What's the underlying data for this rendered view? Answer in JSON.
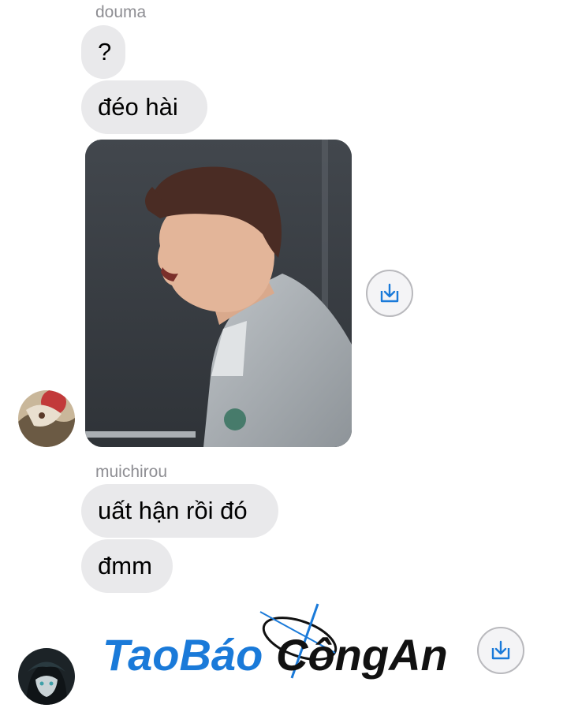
{
  "thread": {
    "group1": {
      "sender": "douma",
      "messages": [
        "?",
        "đéo hài"
      ]
    },
    "group2": {
      "sender": "muichirou",
      "messages": [
        "uất hận rồi đó",
        "đmm"
      ]
    }
  },
  "watermark": {
    "text_part1": "TaoBáo",
    "text_part2": "CôngAn"
  },
  "icons": {
    "save": "download-icon",
    "avatar1": "avatar-douma",
    "avatar2": "avatar-muichirou"
  },
  "colors": {
    "bubble": "#e9e9eb",
    "accent": "#1a7ad9",
    "sender_label": "#8e8e93"
  }
}
